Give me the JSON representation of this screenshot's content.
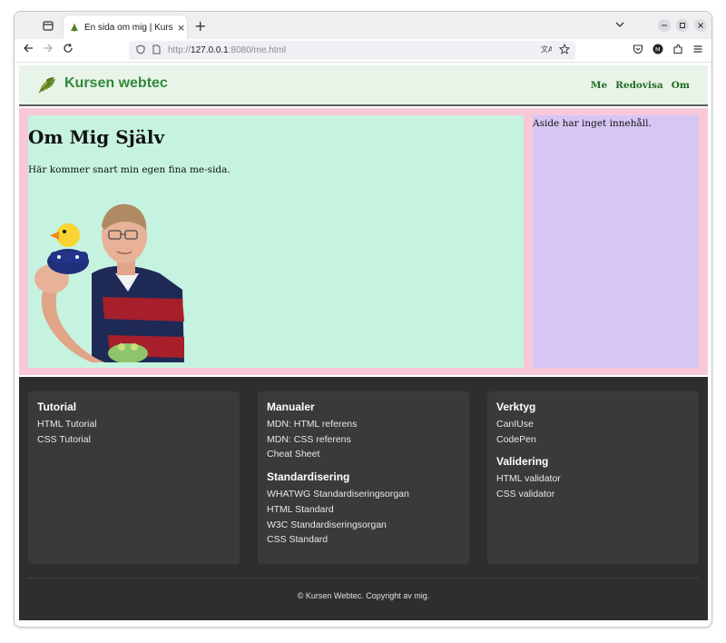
{
  "browser": {
    "tab_title": "En sida om mig | Kursen webtec",
    "tab_close": "×",
    "new_tab": "+",
    "url_prefix": "http://",
    "url_host": "127.0.0.1",
    "url_rest": ":8080/me.html"
  },
  "site": {
    "title": "Kursen webtec",
    "nav": [
      "Me",
      "Redovisa",
      "Om"
    ]
  },
  "article": {
    "title": "Om Mig Själv",
    "text": "Här kommer snart min egen fina me-sida."
  },
  "aside": {
    "text": "Aside har inget innehåll."
  },
  "footer": {
    "columns": [
      {
        "sections": [
          {
            "heading": "Tutorial",
            "links": [
              "HTML Tutorial",
              "CSS Tutorial"
            ]
          }
        ]
      },
      {
        "sections": [
          {
            "heading": "Manualer",
            "links": [
              "MDN: HTML referens",
              "MDN: CSS referens",
              "Cheat Sheet"
            ]
          },
          {
            "heading": "Standardisering",
            "links": [
              "WHATWG Standardiseringsorgan",
              "HTML Standard",
              "W3C Standardiseringsorgan",
              "CSS Standard"
            ]
          }
        ]
      },
      {
        "sections": [
          {
            "heading": "Verktyg",
            "links": [
              "CanIUse",
              "CodePen"
            ]
          },
          {
            "heading": "Validering",
            "links": [
              "HTML validator",
              "CSS validator"
            ]
          }
        ]
      }
    ],
    "copyright": "© Kursen Webtec. Copyright av mig."
  },
  "colors": {
    "header_bg": "#e8f4e8",
    "brand_green": "#2f8a3a",
    "main_bg": "#f8c8d8",
    "article_bg": "#c6f3e0",
    "aside_bg": "#d7c6f4",
    "footer_bg": "#2e2e2e"
  }
}
